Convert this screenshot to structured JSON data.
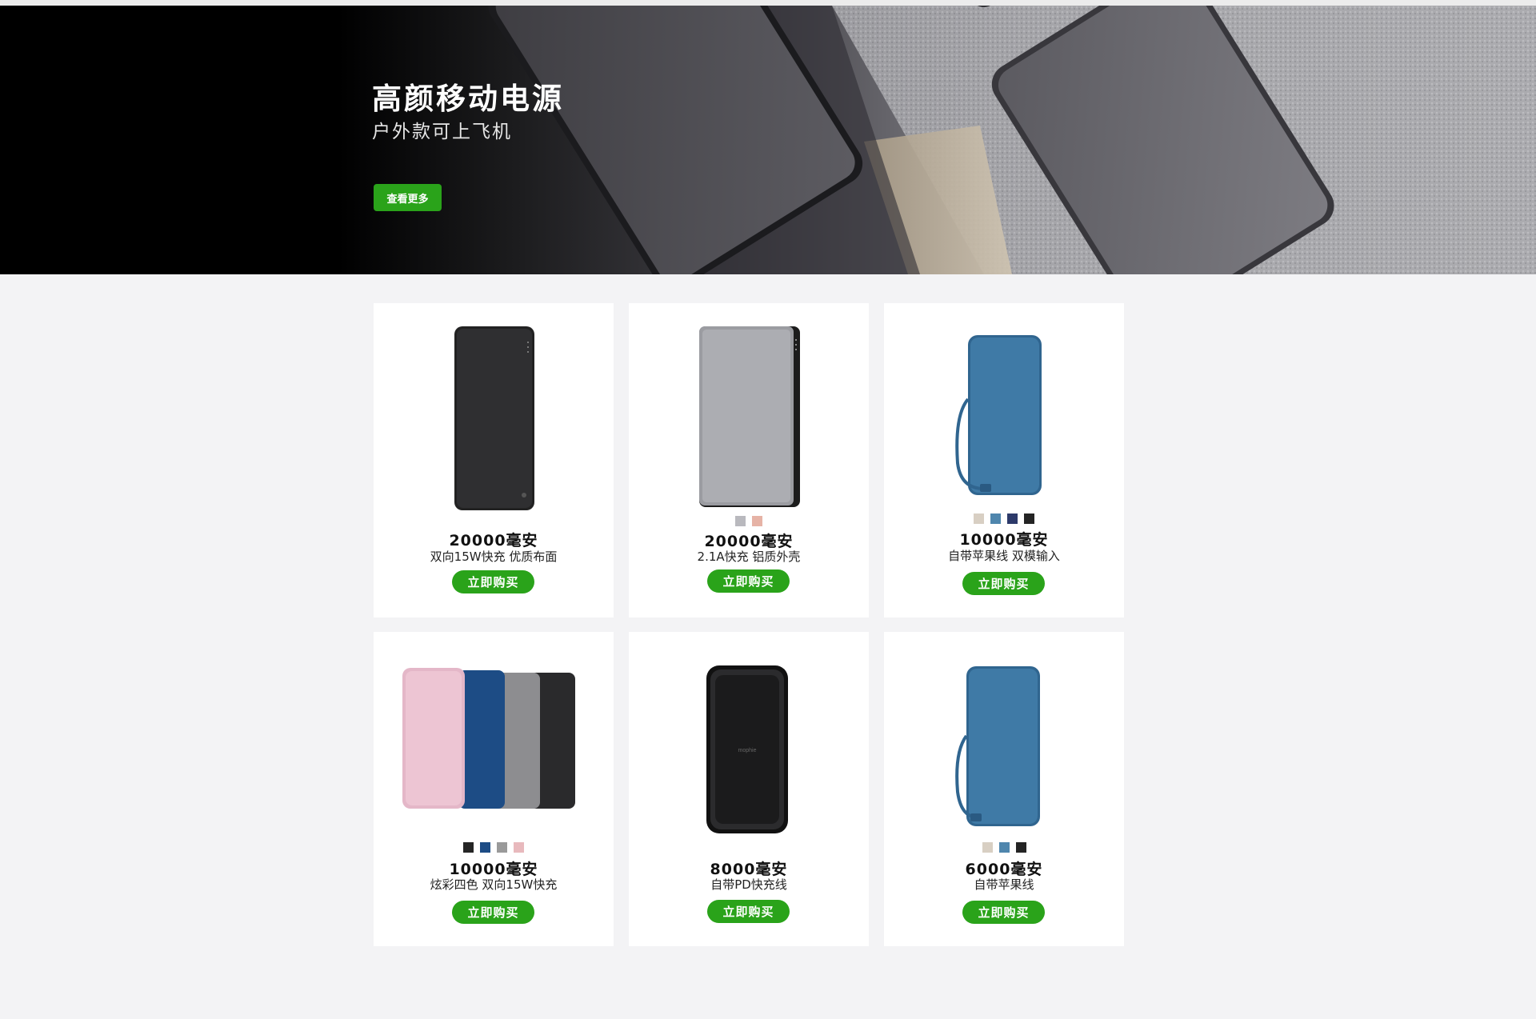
{
  "hero": {
    "title": "高颜移动电源",
    "subtitle": "户外款可上飞机",
    "button_label": "查看更多"
  },
  "colors": {
    "accent_green": "#2aa31a",
    "page_background": "#f3f3f5"
  },
  "products": [
    {
      "capacity": "20000毫安",
      "description": "双向15W快充 优质布面",
      "buy_label": "立即购买",
      "swatches": []
    },
    {
      "capacity": "20000毫安",
      "description": "2.1A快充 铝质外壳",
      "buy_label": "立即购买",
      "swatches": [
        "#b9b9be",
        "#e6b3a6"
      ]
    },
    {
      "capacity": "10000毫安",
      "description": "自带苹果线  双模输入",
      "buy_label": "立即购买",
      "swatches": [
        "#d8cfc3",
        "#4f86ad",
        "#2d3a6a",
        "#242424"
      ]
    },
    {
      "capacity": "10000毫安",
      "description": "炫彩四色 双向15W快充",
      "buy_label": "立即购买",
      "swatches": [
        "#252525",
        "#1d4c85",
        "#9a9a9a",
        "#e8b9bd"
      ]
    },
    {
      "capacity": "8000毫安",
      "description": "自带PD快充线",
      "buy_label": "立即购买",
      "swatches": []
    },
    {
      "capacity": "6000毫安",
      "description": "自带苹果线",
      "buy_label": "立即购买",
      "swatches": [
        "#d8cfc3",
        "#4f86ad",
        "#242424"
      ]
    }
  ],
  "brand_mark": "mophie"
}
